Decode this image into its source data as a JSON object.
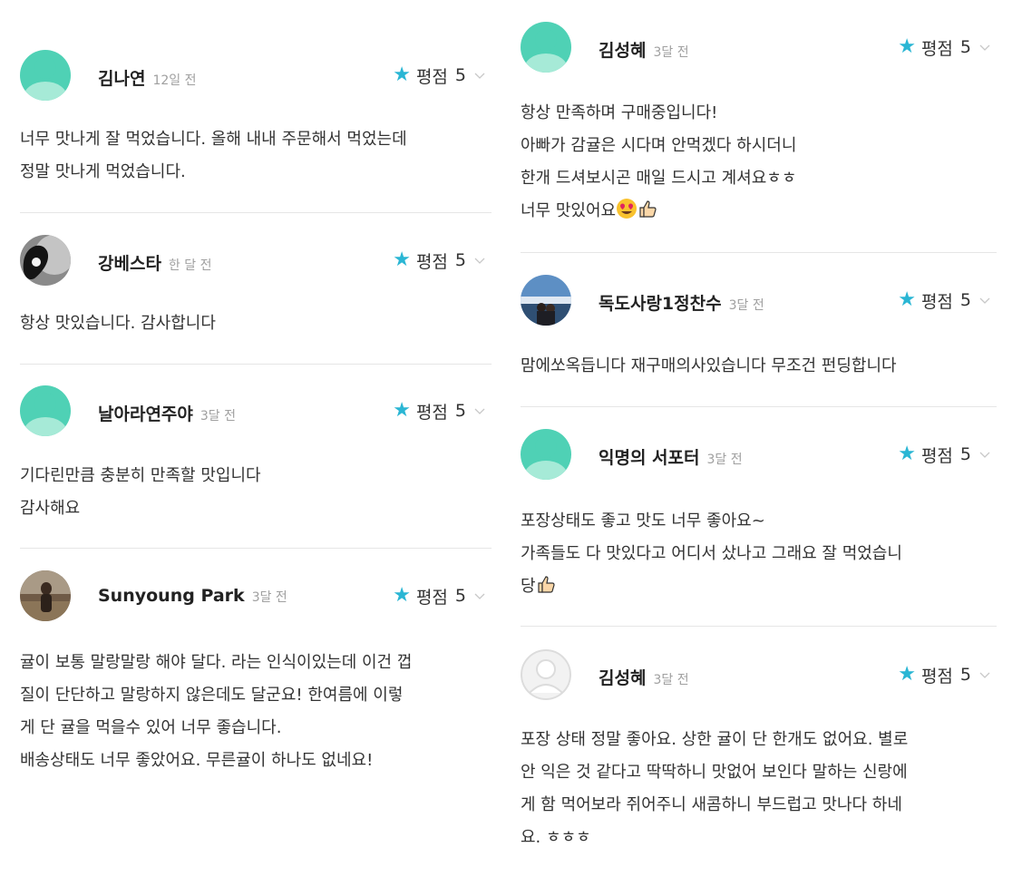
{
  "rating_label": "평점",
  "reviews_left": [
    {
      "name": "김나연",
      "time": "12일 전",
      "rating": "5",
      "avatar": "default-avatar-icon",
      "text": "너무 맛나게 잘 먹었습니다. 올해 내내 주문해서 먹었는데\n정말 맛나게 먹었습니다."
    },
    {
      "name": "강베스타",
      "time": "한 달 전",
      "rating": "5",
      "avatar": "profile-photo",
      "text": "항상 맛있습니다. 감사합니다"
    },
    {
      "name": "날아라연주야",
      "time": "3달 전",
      "rating": "5",
      "avatar": "default-avatar-icon",
      "text": "기다린만큼 충분히 만족할 맛입니다\n감사해요"
    },
    {
      "name": "Sunyoung Park",
      "time": "3달 전",
      "rating": "5",
      "avatar": "profile-photo",
      "text": "귤이 보통 말랑말랑 해야 달다. 라는 인식이있는데 이건 껍\n질이 단단하고 말랑하지 않은데도 달군요! 한여름에 이렇\n게 단 귤을 먹을수 있어 너무 좋습니다.\n배송상태도 너무 좋았어요. 무른귤이 하나도 없네요!"
    }
  ],
  "reviews_right": [
    {
      "name": "김성혜",
      "time": "3달 전",
      "rating": "5",
      "avatar": "default-avatar-icon",
      "text": "항상 만족하며 구매중입니다!\n아빠가 감귤은 시다며 안먹겠다 하시더니\n한개 드셔보시곤 매일 드시고 계셔요ㅎㅎ\n너무 맛있어요",
      "emojis": [
        "heart-eyes-emoji",
        "thumbs-up-emoji"
      ]
    },
    {
      "name": "독도사랑1정찬수",
      "time": "3달 전",
      "rating": "5",
      "avatar": "profile-photo",
      "text": "맘에쏘옥듭니다 재구매의사있습니다 무조건 펀딩합니다"
    },
    {
      "name": "익명의 서포터",
      "time": "3달 전",
      "rating": "5",
      "avatar": "default-avatar-icon",
      "text": "포장상태도 좋고 맛도 너무 좋아요~\n가족들도 다 맛있다고 어디서 샀나고 그래요 잘 먹었습니\n당",
      "emojis": [
        "thumbs-up-emoji"
      ]
    },
    {
      "name": "김성혜",
      "time": "3달 전",
      "rating": "5",
      "avatar": "gray-avatar-icon",
      "text": "포장 상태 정말 좋아요. 상한 귤이 단 한개도 없어요. 별로\n안 익은 것 같다고 딱딱하니 맛없어 보인다 말하는 신랑에\n게 함 먹어보라 쥐어주니 새콤하니 부드럽고 맛나다 하네\n요. ㅎㅎㅎ"
    }
  ],
  "colors": {
    "star": "#2ab6d4",
    "avatar_default": "#4fd1b5",
    "divider": "#e6e6e6"
  }
}
